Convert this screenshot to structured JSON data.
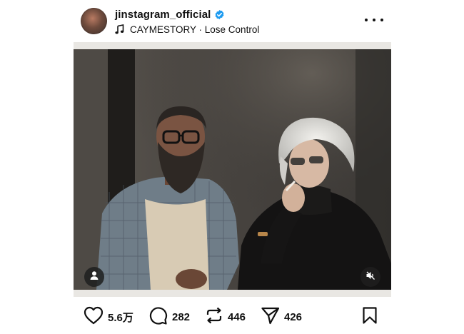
{
  "post": {
    "username": "jinstagram_official",
    "verified": true,
    "audio": "CAYMESTORY · Lose Control",
    "icons": {
      "avatar": "profile-avatar",
      "verified": "verified-badge-icon",
      "audio": "music-note-icon",
      "more": "more-options-icon",
      "user_tag": "person-icon",
      "mute": "speaker-muted-icon"
    }
  },
  "actions": {
    "likes": "5.6万",
    "comments": "282",
    "reposts": "446",
    "shares": "426"
  },
  "colors": {
    "verified_blue": "#1d9bf0",
    "text": "#111111",
    "background": "#ffffff"
  }
}
